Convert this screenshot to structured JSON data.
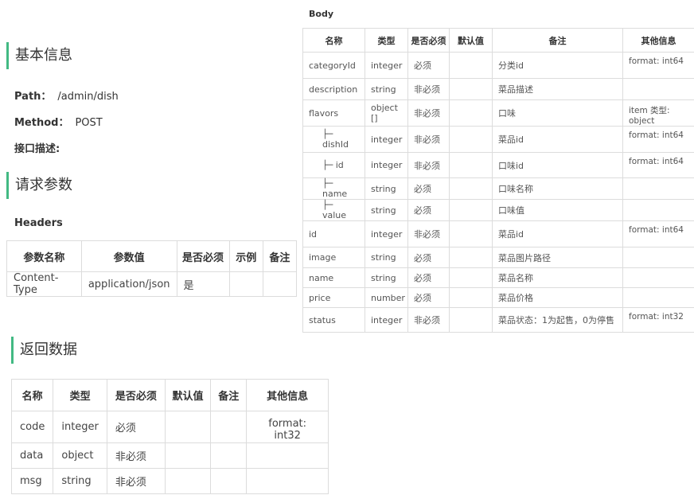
{
  "basic": {
    "title": "基本信息",
    "path_label": "Path：",
    "path_value": "/admin/dish",
    "method_label": "Method：",
    "method_value": "POST",
    "desc_label": "接口描述:"
  },
  "request": {
    "title": "请求参数",
    "headers_title": "Headers",
    "headers_columns": [
      "参数名称",
      "参数值",
      "是否必须",
      "示例",
      "备注"
    ],
    "headers_rows": [
      [
        "Content-Type",
        "application/json",
        "是",
        "",
        ""
      ]
    ],
    "body_title": "Body",
    "body_columns": [
      "名称",
      "类型",
      "是否必须",
      "默认值",
      "备注",
      "其他信息"
    ],
    "body_rows": [
      {
        "name": "categoryId",
        "type": "integer",
        "required": "必须",
        "default": "",
        "note": "分类id",
        "other": "format: int64"
      },
      {
        "name": "description",
        "type": "string",
        "required": "非必须",
        "default": "",
        "note": "菜品描述",
        "other": ""
      },
      {
        "name": "flavors",
        "type": "object []",
        "required": "非必须",
        "default": "",
        "note": "口味",
        "other": "item 类型: object"
      },
      {
        "name": "├─ dishId",
        "type": "integer",
        "required": "非必须",
        "default": "",
        "note": "菜品id",
        "other": "format: int64"
      },
      {
        "name": "├─ id",
        "type": "integer",
        "required": "非必须",
        "default": "",
        "note": "口味id",
        "other": "format: int64"
      },
      {
        "name": "├─ name",
        "type": "string",
        "required": "必须",
        "default": "",
        "note": "口味名称",
        "other": ""
      },
      {
        "name": "├─ value",
        "type": "string",
        "required": "必须",
        "default": "",
        "note": "口味值",
        "other": ""
      },
      {
        "name": "id",
        "type": "integer",
        "required": "非必须",
        "default": "",
        "note": "菜品id",
        "other": "format: int64"
      },
      {
        "name": "image",
        "type": "string",
        "required": "必须",
        "default": "",
        "note": "菜品图片路径",
        "other": ""
      },
      {
        "name": "name",
        "type": "string",
        "required": "必须",
        "default": "",
        "note": "菜品名称",
        "other": ""
      },
      {
        "name": "price",
        "type": "number",
        "required": "必须",
        "default": "",
        "note": "菜品价格",
        "other": ""
      },
      {
        "name": "status",
        "type": "integer",
        "required": "非必须",
        "default": "",
        "note": "菜品状态：1为起售，0为停售",
        "other": "format: int32"
      }
    ]
  },
  "response": {
    "title": "返回数据",
    "columns": [
      "名称",
      "类型",
      "是否必须",
      "默认值",
      "备注",
      "其他信息"
    ],
    "rows": [
      {
        "name": "code",
        "type": "integer",
        "required": "必须",
        "default": "",
        "note": "",
        "other": "format: int32"
      },
      {
        "name": "data",
        "type": "object",
        "required": "非必须",
        "default": "",
        "note": "",
        "other": ""
      },
      {
        "name": "msg",
        "type": "string",
        "required": "非必须",
        "default": "",
        "note": "",
        "other": ""
      }
    ]
  },
  "colors": {
    "accent": "#42b983",
    "border": "#dcdcdc"
  }
}
